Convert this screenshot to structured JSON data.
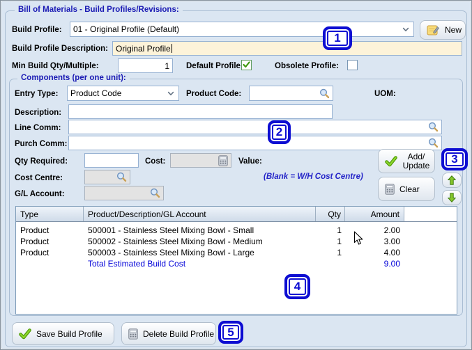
{
  "window": {
    "title": "Bill of Materials - Build Profiles/Revisions:"
  },
  "header": {
    "build_profile": {
      "label": "Build Profile:",
      "value": "01 - Original Profile (Default)"
    },
    "description": {
      "label": "Build Profile Description:",
      "value": "Original Profile"
    },
    "min_build": {
      "label": "Min Build Qty/Multiple:",
      "value": "1"
    },
    "default_profile": {
      "label": "Default Profile:",
      "checked": true
    },
    "obsolete_profile": {
      "label": "Obsolete Profile:",
      "checked": false
    }
  },
  "components": {
    "title": "Components (per one unit):",
    "entry_type": {
      "label": "Entry Type:",
      "value": "Product Code"
    },
    "product_code": {
      "label": "Product Code:",
      "value": ""
    },
    "uom": {
      "label": "UOM:"
    },
    "description": {
      "label": "Description:",
      "value": ""
    },
    "line_comm": {
      "label": "Line Comm:",
      "value": ""
    },
    "purch_comm": {
      "label": "Purch Comm:",
      "value": ""
    },
    "qty_required": {
      "label": "Qty Required:",
      "value": ""
    },
    "cost": {
      "label": "Cost:",
      "value": ""
    },
    "value": {
      "label": "Value:"
    },
    "cost_centre": {
      "label": "Cost Centre:",
      "value": "",
      "hint": "(Blank = W/H Cost Centre)"
    },
    "gl_account": {
      "label": "G/L Account:",
      "value": ""
    }
  },
  "buttons": {
    "new": {
      "label": "New"
    },
    "add_update": {
      "line1": "Add/",
      "line2": "Update"
    },
    "clear": {
      "label": "Clear"
    },
    "save": {
      "label": "Save Build Profile"
    },
    "delete": {
      "label": "Delete Build Profile"
    }
  },
  "table": {
    "columns": [
      "Type",
      "Product/Description/GL Account",
      "Qty",
      "Amount"
    ],
    "rows": [
      {
        "type": "Product",
        "description": "500001 - Stainless Steel Mixing Bowl - Small",
        "qty": "1",
        "amount": "2.00"
      },
      {
        "type": "Product",
        "description": "500002 - Stainless Steel Mixing Bowl - Medium",
        "qty": "1",
        "amount": "3.00"
      },
      {
        "type": "Product",
        "description": "500003 - Stainless Steel Mixing Bowl - Large",
        "qty": "1",
        "amount": "4.00"
      }
    ],
    "total_label": "Total Estimated Build Cost",
    "total_value": "9.00"
  },
  "annotations": [
    "1",
    "2",
    "3",
    "4",
    "5"
  ],
  "colors": {
    "window_background": "#dbe6f2",
    "group_title_blue": "#1b1bb4",
    "description_field_cream": "#fdf3d9",
    "badge_blue": "#0d0dd2",
    "total_blue": "#0000d8",
    "hint_blue": "#2424c8",
    "check_green": "#6cb41e",
    "arrow_green": "#86c62c"
  }
}
